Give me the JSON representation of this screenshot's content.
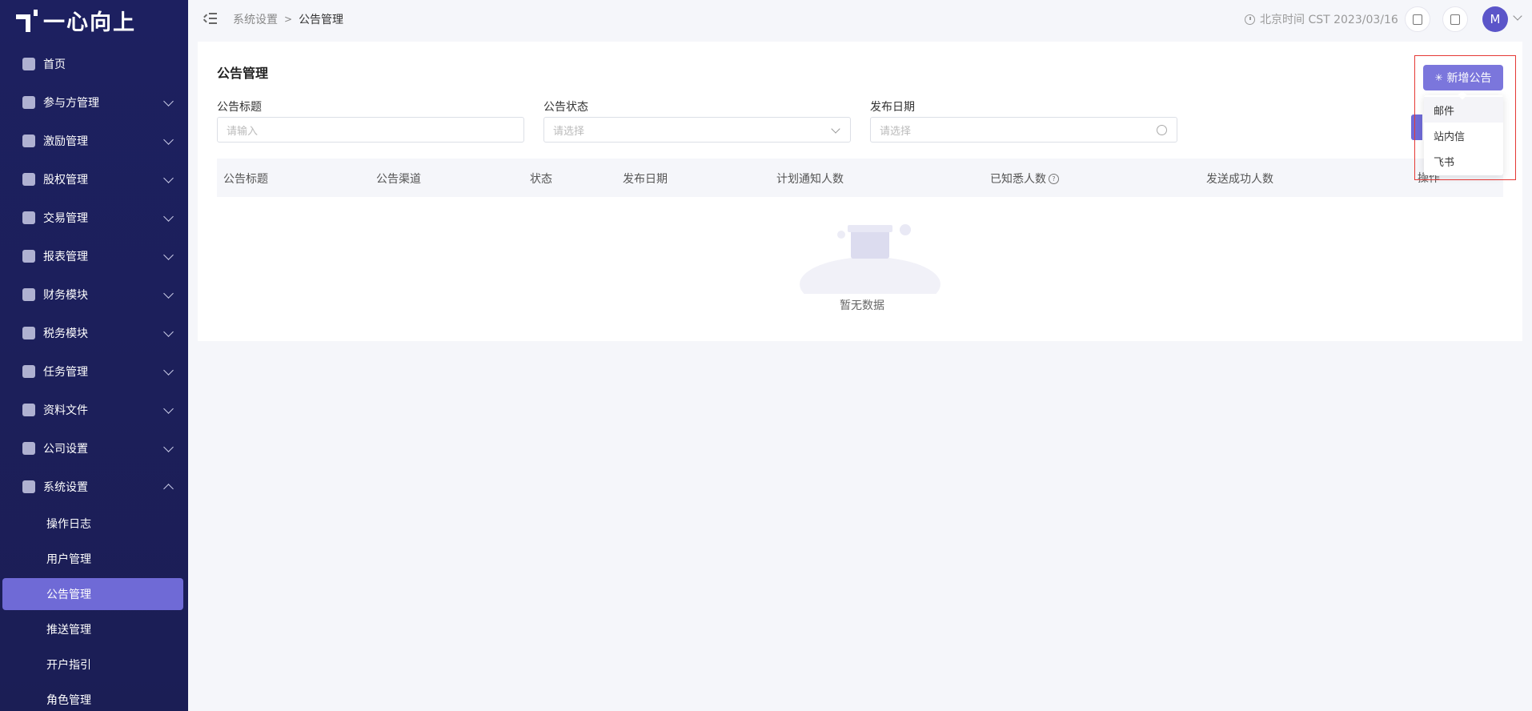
{
  "brand": {
    "name": "一心向上"
  },
  "sidebar": {
    "items": [
      {
        "label": "首页",
        "icon": "home-icon",
        "expandable": false
      },
      {
        "label": "参与方管理",
        "icon": "participant-icon",
        "expandable": true
      },
      {
        "label": "激励管理",
        "icon": "incentive-icon",
        "expandable": true
      },
      {
        "label": "股权管理",
        "icon": "equity-icon",
        "expandable": true
      },
      {
        "label": "交易管理",
        "icon": "trade-icon",
        "expandable": true
      },
      {
        "label": "报表管理",
        "icon": "report-icon",
        "expandable": true
      },
      {
        "label": "财务模块",
        "icon": "finance-icon",
        "expandable": true
      },
      {
        "label": "税务模块",
        "icon": "tax-icon",
        "expandable": true
      },
      {
        "label": "任务管理",
        "icon": "task-icon",
        "expandable": true
      },
      {
        "label": "资料文件",
        "icon": "folder-icon",
        "expandable": true
      },
      {
        "label": "公司设置",
        "icon": "company-icon",
        "expandable": true
      },
      {
        "label": "系统设置",
        "icon": "system-icon",
        "expandable": true,
        "expanded": true
      }
    ],
    "sub_items": [
      {
        "label": "操作日志",
        "active": false
      },
      {
        "label": "用户管理",
        "active": false
      },
      {
        "label": "公告管理",
        "active": true
      },
      {
        "label": "推送管理",
        "active": false
      },
      {
        "label": "开户指引",
        "active": false
      },
      {
        "label": "角色管理",
        "active": false
      }
    ]
  },
  "header": {
    "breadcrumb": [
      "系统设置",
      "公告管理"
    ],
    "time_label": "北京时间 CST 2023/03/16",
    "avatar_initial": "M"
  },
  "main": {
    "title": "公告管理",
    "filters": {
      "title_label": "公告标题",
      "title_placeholder": "请输入",
      "status_label": "公告状态",
      "status_placeholder": "请选择",
      "date_label": "发布日期",
      "date_placeholder": "请选择"
    },
    "add_button": "新增公告",
    "dropdown_items": [
      "邮件",
      "站内信",
      "飞书"
    ],
    "table": {
      "columns": [
        "公告标题",
        "公告渠道",
        "状态",
        "发布日期",
        "计划通知人数",
        "已知悉人数",
        "发送成功人数",
        "操作"
      ],
      "empty_text": "暂无数据"
    }
  },
  "colors": {
    "sidebar_bg": "#1d2060",
    "accent": "#6f6ad6",
    "highlight_box": "#e53935"
  }
}
